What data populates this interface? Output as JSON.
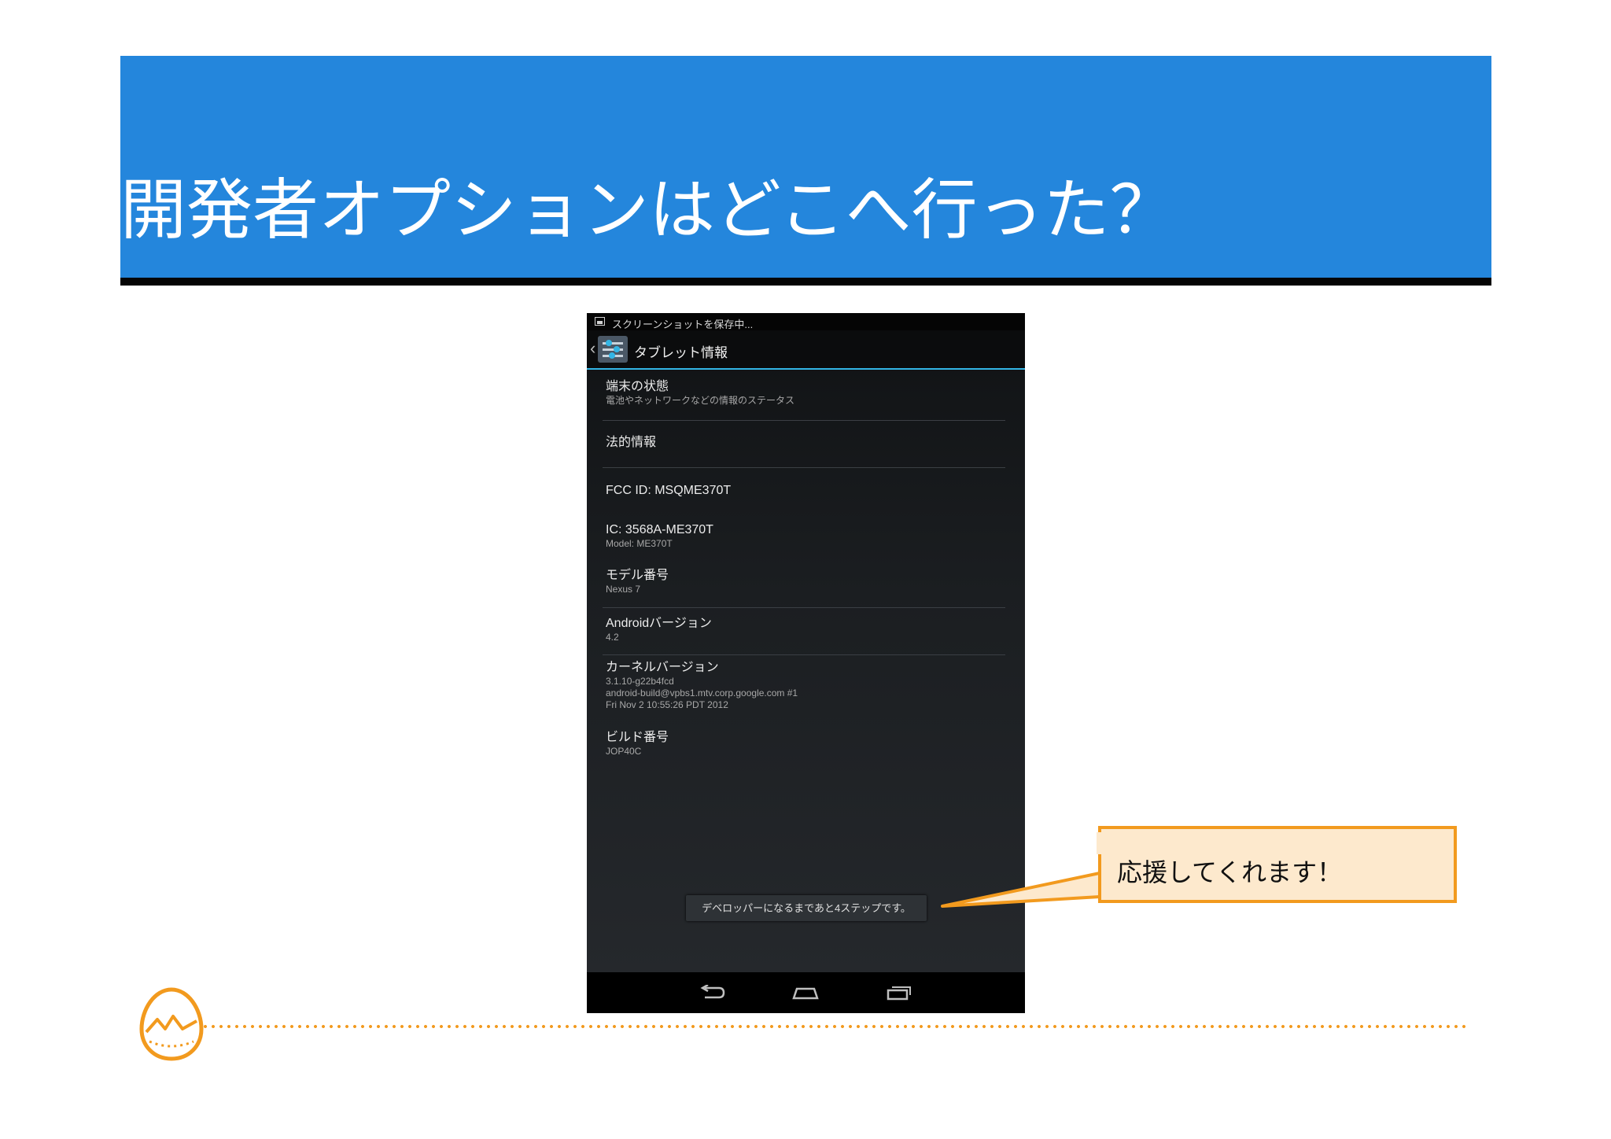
{
  "slide": {
    "title": "開発者オプションはどこへ行った？"
  },
  "phone": {
    "status_bar": {
      "text": "スクリーンショットを保存中..."
    },
    "action_bar": {
      "title": "タブレット情報"
    },
    "items": [
      {
        "title": "端末の状態",
        "subtitle": "電池やネットワークなどの情報のステータス"
      },
      {
        "title": "法的情報",
        "subtitle": ""
      },
      {
        "title": "FCC ID: MSQME370T",
        "subtitle": ""
      },
      {
        "title": "IC: 3568A-ME370T",
        "subtitle": "Model: ME370T"
      },
      {
        "title": "モデル番号",
        "subtitle": "Nexus 7"
      },
      {
        "title": "Androidバージョン",
        "subtitle": "4.2"
      },
      {
        "title": "カーネルバージョン",
        "subtitle_lines": [
          "3.1.10-g22b4fcd",
          "android-build@vpbs1.mtv.corp.google.com #1",
          "Fri Nov 2 10:55:26 PDT 2012"
        ]
      },
      {
        "title": "ビルド番号",
        "subtitle": "JOP40C"
      }
    ],
    "toast": "デベロッパーになるまであと4ステップです。",
    "nav": {
      "back": "back-icon",
      "home": "home-icon",
      "recent": "recent-apps-icon"
    }
  },
  "callout": {
    "text": "応援してくれます！"
  },
  "colors": {
    "banner": "#2486dc",
    "accent_orange": "#f29a1e",
    "callout_fill": "#fde9cd",
    "holo_blue": "#33b5e5"
  }
}
